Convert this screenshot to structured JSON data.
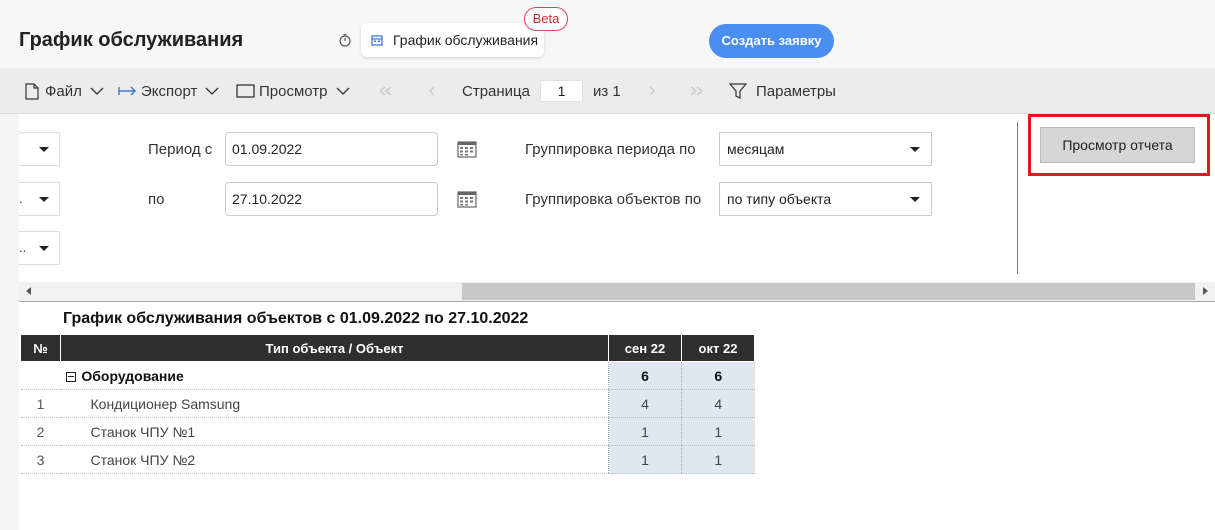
{
  "header": {
    "title": "График обслуживания",
    "tab_label": "График обслуживания",
    "beta_label": "Beta",
    "create_button": "Создать заявку"
  },
  "toolbar": {
    "file": "Файл",
    "export": "Экспорт",
    "view": "Просмотр",
    "page_label": "Страница",
    "page_value": "1",
    "page_of": "из 1",
    "params": "Параметры"
  },
  "params": {
    "small_dropdowns": [
      "",
      ".",
      ".."
    ],
    "period_from_label": "Период с",
    "period_from": "01.09.2022",
    "period_to_label": "по",
    "period_to": "27.10.2022",
    "period_group_label": "Группировка периода по",
    "period_group_value": "месяцам",
    "object_group_label": "Группировка объектов по",
    "object_group_value": "по типу объекта",
    "view_report_button": "Просмотр отчета"
  },
  "report": {
    "title": "График обслуживания объектов с 01.09.2022 по 27.10.2022",
    "columns": [
      "№",
      "Тип объекта / Объект",
      "сен 22",
      "окт 22"
    ],
    "group": {
      "name": "Оборудование",
      "values": [
        "6",
        "6"
      ]
    },
    "rows": [
      {
        "num": "1",
        "name": "Кондиционер Samsung",
        "values": [
          "4",
          "4"
        ]
      },
      {
        "num": "2",
        "name": "Станок ЧПУ №1",
        "values": [
          "1",
          "1"
        ]
      },
      {
        "num": "3",
        "name": "Станок ЧПУ №2",
        "values": [
          "1",
          "1"
        ]
      }
    ]
  },
  "colors": {
    "accent": "#4a8ef2",
    "highlight": "#e8141b",
    "table_header": "#2f2f2f",
    "month_cell": "#dfe7f0"
  }
}
